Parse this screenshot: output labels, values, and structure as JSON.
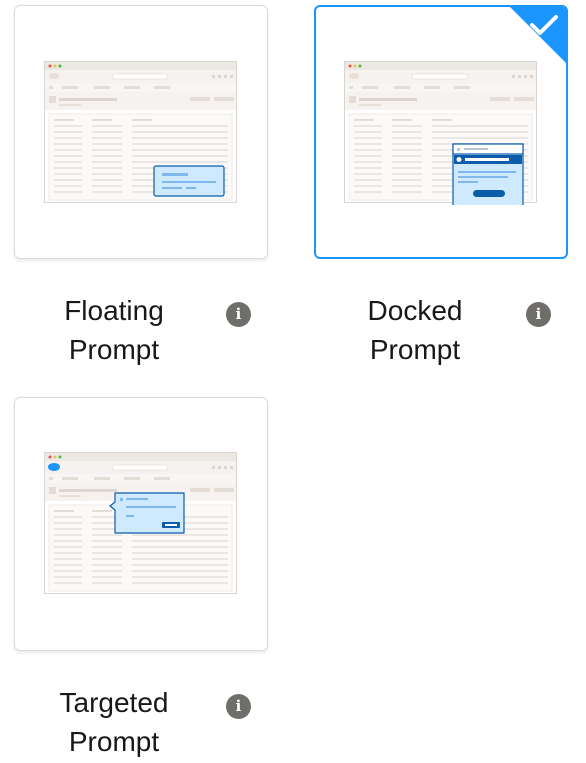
{
  "options": [
    {
      "id": "floating",
      "label_line1": "Floating",
      "label_line2": "Prompt",
      "selected": false
    },
    {
      "id": "docked",
      "label_line1": "Docked",
      "label_line2": "Prompt",
      "selected": true
    },
    {
      "id": "targeted",
      "label_line1": "Targeted",
      "label_line2": "Prompt",
      "selected": false
    }
  ],
  "info_glyph": "i",
  "colors": {
    "selected_border": "#1b96ff",
    "prompt_fill": "#cfe9fe",
    "prompt_border": "#0b5cab",
    "info_icon": "#706e6b"
  }
}
